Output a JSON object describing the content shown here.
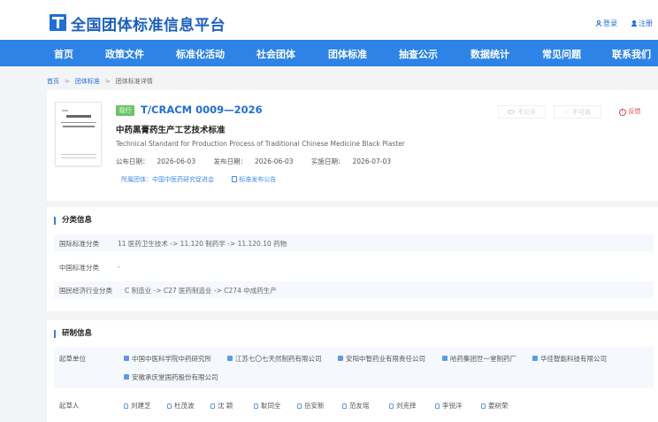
{
  "header": {
    "site_title": "全国团体标准信息平台",
    "login": "登录",
    "register": "注册"
  },
  "nav": {
    "items": [
      "首页",
      "政策文件",
      "标准化活动",
      "社会团体",
      "团体标准",
      "抽查公示",
      "数据统计",
      "常见问题",
      "联系我们"
    ]
  },
  "breadcrumb": {
    "home": "首页",
    "group_standard": "团体标准",
    "current": "团体标准详情",
    "separator": ">"
  },
  "standard": {
    "status": "现行",
    "code": "T/CRACM 0009—2026",
    "title_cn": "中药黑膏药生产工艺技术标准",
    "title_en": "Technical Standard for Production Process of Traditional Chinese Medicine Black Plaster",
    "publish_date_label": "公布日期：",
    "publish_date": "2026-06-03",
    "issue_date_label": "发布日期：",
    "issue_date": "2026-06-03",
    "effective_date_label": "实施日期：",
    "effective_date": "2026-07-03",
    "owner_label": "所属团体：",
    "owner": "中国中医药研究促进会",
    "announcement": "标准发布公告"
  },
  "actions": {
    "public": "不公开",
    "collect": "不可收",
    "feedback": "反馈"
  },
  "classification": {
    "section_title": "分类信息",
    "ics_label": "国际标准分类",
    "ics_value": "11 医药卫生技术 -> 11.120 制药学 -> 11.120.10 药物",
    "ccs_label": "中国标准分类",
    "ccs_value": "-",
    "industry_label": "国民经济行业分类",
    "industry_value": "C 制造业 -> C27 医药制造业 -> C274 中成药生产"
  },
  "drafting": {
    "section_title": "研制信息",
    "units_label": "起草单位",
    "units": [
      "中国中医科学院中药研究所",
      "江苏七〇七天然制药有限公司",
      "安阳中智药业有限责任公司",
      "哈药集团世一堂制药厂",
      "华佳智能科技有限公司",
      "安徽承庆堂国药股份有限公司"
    ],
    "drafters_label": "起草人",
    "drafters": [
      "刘建芝",
      "杜茂波",
      "沈  颖",
      "耿同全",
      "岳安新",
      "范友瑶",
      "刘克择",
      "李锐洋",
      "姜树荣"
    ]
  },
  "colors": {
    "brand_blue": "#1f6fd6",
    "nav_blue": "#2d84e6",
    "status_green": "#6cc466",
    "feedback_red": "#e34b4b"
  }
}
